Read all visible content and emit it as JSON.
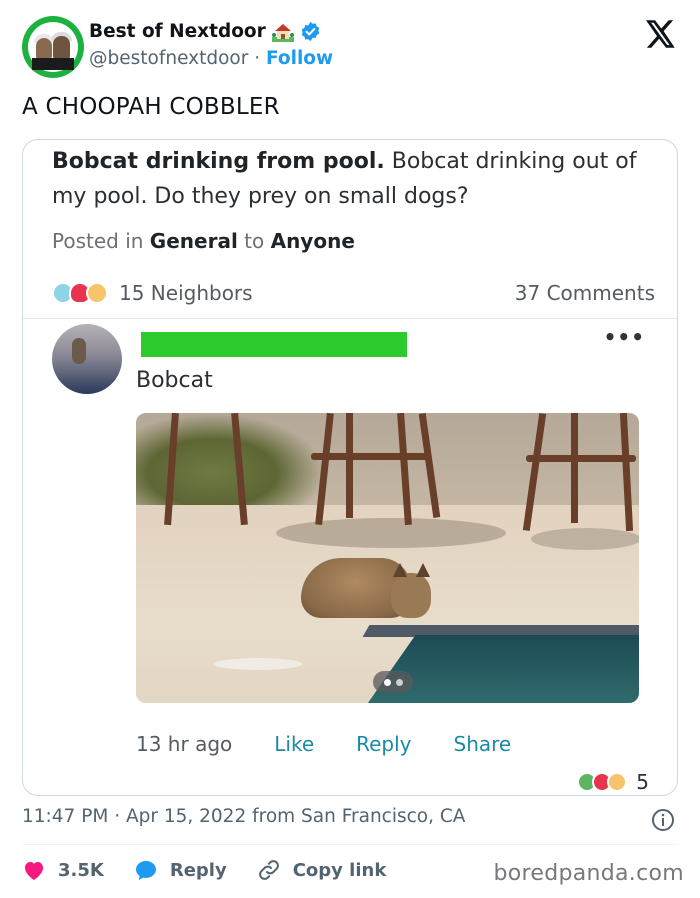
{
  "account": {
    "display_name": "Best of Nextdoor",
    "name_emoji": "house-with-garden-icon",
    "verified": true,
    "handle": "@bestofnextdoor",
    "separator": "·",
    "follow_label": "Follow"
  },
  "tweet": {
    "text": "A CHOOPAH COBBLER"
  },
  "embedded_post": {
    "title": "Bobcat drinking from pool.",
    "body": "Bobcat drinking out of my pool. Do they prey on small dogs?",
    "posted_in_prefix": "Posted in",
    "category": "General",
    "to_label": "to",
    "audience": "Anyone",
    "reaction_icons": [
      "sad-face-icon",
      "heart-icon",
      "surprised-face-icon"
    ],
    "neighbors_count": "15 Neighbors",
    "comments_count": "37 Comments",
    "comment": {
      "text": "Bobcat",
      "more_label": "•••",
      "time_ago": "13 hr ago",
      "like_label": "Like",
      "reply_label": "Reply",
      "share_label": "Share",
      "reaction_icons": [
        "plus-one-icon",
        "heart-icon",
        "surprised-face-icon"
      ],
      "reaction_count": "5"
    }
  },
  "footer": {
    "timestamp": "11:47 PM · Apr 15, 2022 from San Francisco, CA",
    "like_count": "3.5K",
    "reply_label": "Reply",
    "copy_link_label": "Copy link",
    "watermark": "boredpanda.com"
  },
  "colors": {
    "brand_green": "#1db23f",
    "link_blue": "#1d9bf0",
    "like_pink": "#f91880",
    "nextdoor_teal": "#1b8aa8",
    "redaction_green": "#2dca2d"
  }
}
